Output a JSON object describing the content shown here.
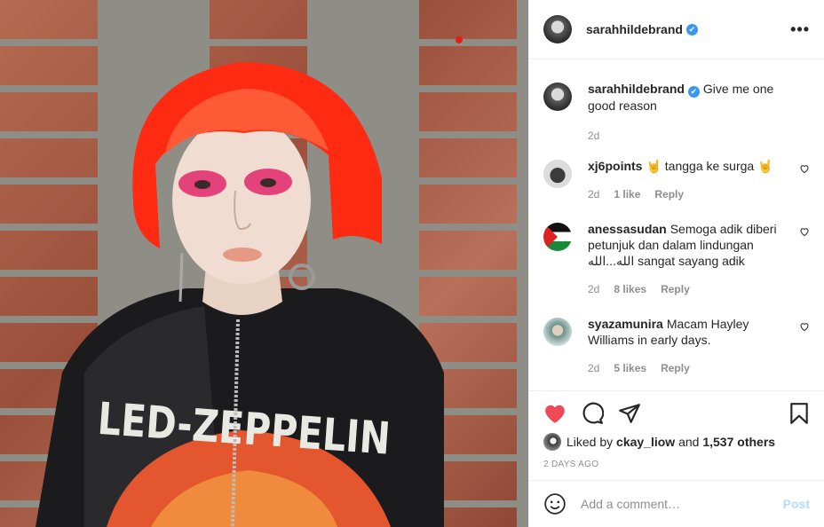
{
  "post": {
    "author": "sarahhildebrand",
    "verified_mark": "✔",
    "more_label": "•••",
    "caption_text": "Give me one good reason",
    "caption_age": "2d"
  },
  "comments": [
    {
      "username": "xj6points",
      "text": "🤘 tangga ke surga 🤘",
      "age": "2d",
      "likes": "1 like",
      "reply": "Reply"
    },
    {
      "username": "anessasudan",
      "text": "Semoga adik diberi petunjuk dan dalam lindungan الله...الله sangat sayang adik",
      "age": "2d",
      "likes": "8 likes",
      "reply": "Reply"
    },
    {
      "username": "syazamunira",
      "text": "Macam Hayley Williams in early days.",
      "age": "2d",
      "likes": "5 likes",
      "reply": "Reply"
    }
  ],
  "likes": {
    "prefix": "Liked by",
    "first_user": "ckay_liow",
    "joiner": "and",
    "others": "1,537 others"
  },
  "posted_time": "2 DAYS AGO",
  "add_comment": {
    "placeholder": "Add a comment…",
    "post_label": "Post"
  },
  "photo": {
    "shirt_text": "LED-ZEPPELIN"
  },
  "icons": {
    "like": "heart-filled-icon",
    "comment": "comment-icon",
    "share": "share-icon",
    "save": "bookmark-icon",
    "emoji": "emoji-icon"
  },
  "colors": {
    "like_red": "#ed4956",
    "verified_blue": "#3897f0",
    "post_disabled": "#b3dbff",
    "hair": "#ff2a12"
  }
}
